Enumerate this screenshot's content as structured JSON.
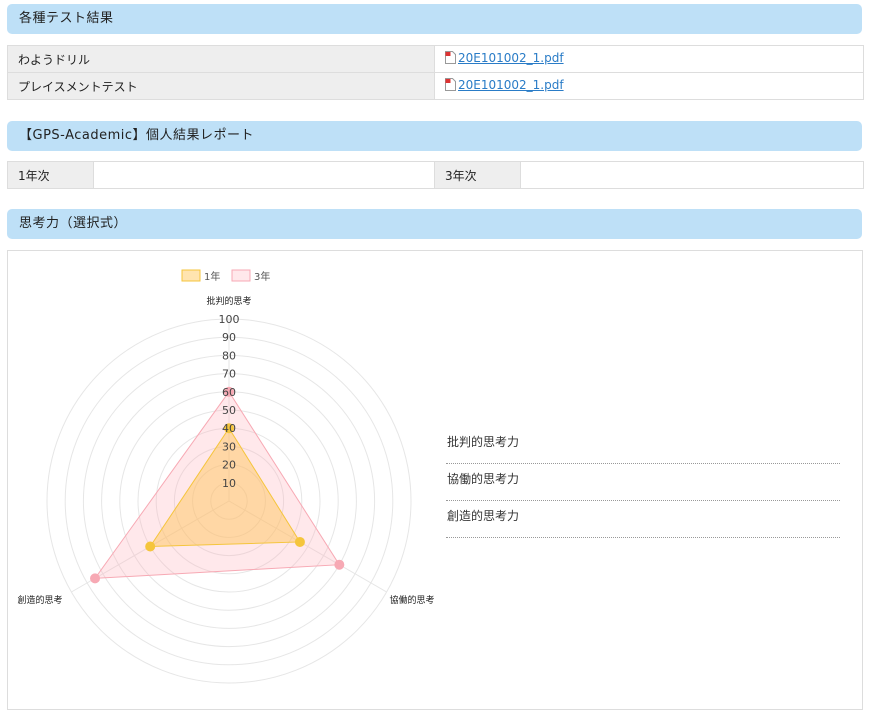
{
  "sections": {
    "tests_title": "各種テスト結果",
    "gps_title": "【GPS-Academic】個人結果レポート",
    "thinking_title": "思考力（選択式）"
  },
  "tests": [
    {
      "name": "わようドリル",
      "file": "20E101002_1.pdf"
    },
    {
      "name": "プレイスメントテスト",
      "file": "20E101002_1.pdf"
    }
  ],
  "gps": {
    "year1_label": "1年次",
    "year1_value": "",
    "year3_label": "3年次",
    "year3_value": ""
  },
  "side_list": [
    "批判的思考力",
    "協働的思考力",
    "創造的思考力"
  ],
  "colors": {
    "header_bg": "#bee0f7",
    "series1_fill": "rgba(255,196,80,0.45)",
    "series1_stroke": "#f5c53c",
    "series3_fill": "rgba(255,180,190,0.30)",
    "series3_stroke": "#f7a9b4",
    "link": "#2a7cc7"
  },
  "chart_data": {
    "type": "radar",
    "axes": [
      "批判的思考",
      "協働的思考",
      "創造的思考"
    ],
    "rlim": [
      0,
      100
    ],
    "ticks": [
      10,
      20,
      30,
      40,
      50,
      60,
      70,
      80,
      90,
      100
    ],
    "legend_position": "top",
    "series": [
      {
        "name": "1年",
        "values": [
          40,
          45,
          50
        ]
      },
      {
        "name": "3年",
        "values": [
          60,
          70,
          85
        ]
      }
    ]
  }
}
